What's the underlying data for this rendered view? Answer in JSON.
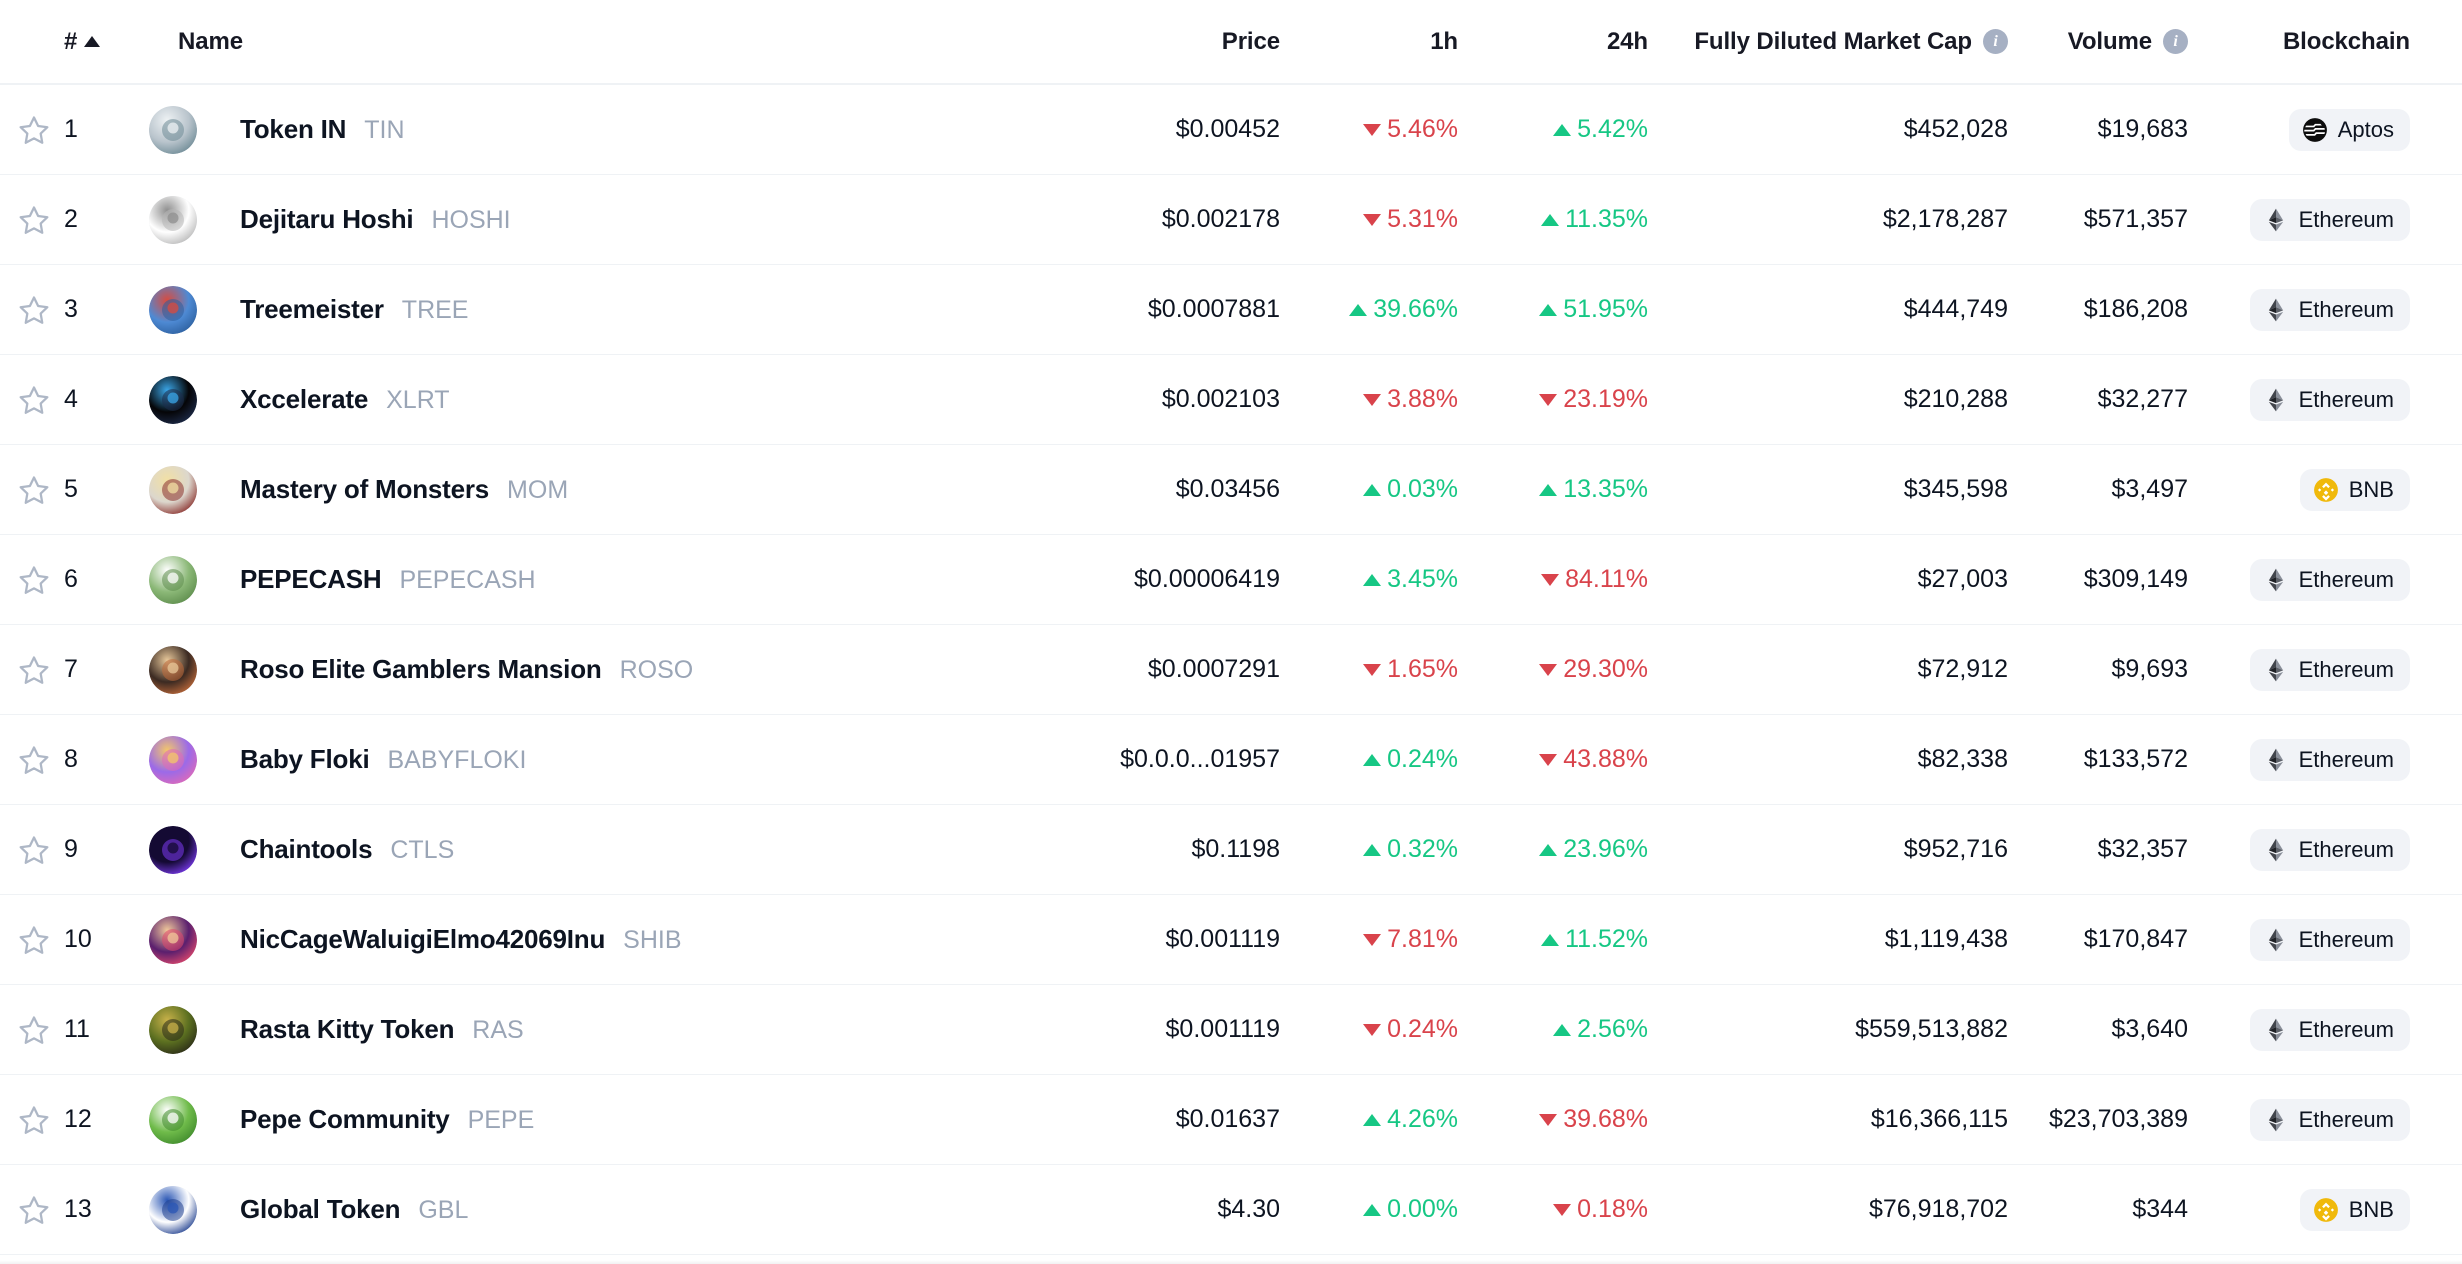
{
  "header": {
    "rank_label": "#",
    "sort_indicator": "ascending-caret",
    "name_label": "Name",
    "price_label": "Price",
    "h1_label": "1h",
    "h24_label": "24h",
    "fdmc_label": "Fully Diluted Market Cap",
    "fdmc_info": "i",
    "volume_label": "Volume",
    "volume_info": "i",
    "blockchain_label": "Blockchain"
  },
  "colors": {
    "up": "#16c784",
    "down": "#d9434b",
    "text": "#0d1421",
    "muted": "#9aa5b6",
    "divider": "#eff2f5",
    "badge_bg": "#f1f3f7",
    "bnb": "#f0b90b"
  },
  "rows": [
    {
      "rank": "1",
      "name": "Token IN",
      "symbol": "TIN",
      "price": "$0.00452",
      "h1": "5.46%",
      "h1_dir": "down",
      "h24": "5.42%",
      "h24_dir": "up",
      "fdmc": "$452,028",
      "volume": "$19,683",
      "chain": "Aptos",
      "chain_icon": "aptos-icon",
      "icon_name": "token-in-logo",
      "icon_colors": [
        "#b9c4cc",
        "#6d8a95",
        "#eef2f4"
      ]
    },
    {
      "rank": "2",
      "name": "Dejitaru Hoshi",
      "symbol": "HOSHI",
      "price": "$0.002178",
      "h1": "5.31%",
      "h1_dir": "down",
      "h24": "11.35%",
      "h24_dir": "up",
      "fdmc": "$2,178,287",
      "volume": "$571,357",
      "chain": "Ethereum",
      "chain_icon": "ethereum-icon",
      "icon_name": "dejitaru-hoshi-logo",
      "icon_colors": [
        "#ffffff",
        "#b7b7b7",
        "#8f8f8f"
      ]
    },
    {
      "rank": "3",
      "name": "Treemeister",
      "symbol": "TREE",
      "price": "$0.0007881",
      "h1": "39.66%",
      "h1_dir": "up",
      "h24": "51.95%",
      "h24_dir": "up",
      "fdmc": "$444,749",
      "volume": "$186,208",
      "chain": "Ethereum",
      "chain_icon": "ethereum-icon",
      "icon_name": "treemeister-logo",
      "icon_colors": [
        "#4e8ad4",
        "#2c5f9e",
        "#d84b3f"
      ]
    },
    {
      "rank": "4",
      "name": "Xccelerate",
      "symbol": "XLRT",
      "price": "$0.002103",
      "h1": "3.88%",
      "h1_dir": "down",
      "h24": "23.19%",
      "h24_dir": "down",
      "fdmc": "$210,288",
      "volume": "$32,277",
      "chain": "Ethereum",
      "chain_icon": "ethereum-icon",
      "icon_name": "xccelerate-logo",
      "icon_colors": [
        "#050507",
        "#1d2b4a",
        "#3aa6e8"
      ]
    },
    {
      "rank": "5",
      "name": "Mastery of Monsters",
      "symbol": "MOM",
      "price": "$0.03456",
      "h1": "0.03%",
      "h1_dir": "up",
      "h24": "13.35%",
      "h24_dir": "up",
      "fdmc": "$345,598",
      "volume": "$3,497",
      "chain": "BNB",
      "chain_icon": "bnb-icon",
      "icon_name": "mastery-of-monsters-logo",
      "icon_colors": [
        "#dcd7cd",
        "#8a2f2c",
        "#f2e0a4"
      ]
    },
    {
      "rank": "6",
      "name": "PEPECASH",
      "symbol": "PEPECASH",
      "price": "$0.00006419",
      "h1": "3.45%",
      "h1_dir": "up",
      "h24": "84.11%",
      "h24_dir": "down",
      "fdmc": "$27,003",
      "volume": "$309,149",
      "chain": "Ethereum",
      "chain_icon": "ethereum-icon",
      "icon_name": "pepecash-logo",
      "icon_colors": [
        "#8bb877",
        "#5d8c4c",
        "#ffffff"
      ]
    },
    {
      "rank": "7",
      "name": "Roso Elite Gamblers Mansion",
      "symbol": "ROSO",
      "price": "$0.0007291",
      "h1": "1.65%",
      "h1_dir": "down",
      "h24": "29.30%",
      "h24_dir": "down",
      "fdmc": "$72,912",
      "volume": "$9,693",
      "chain": "Ethereum",
      "chain_icon": "ethereum-icon",
      "icon_name": "roso-logo",
      "icon_colors": [
        "#3b2a22",
        "#c06a3a",
        "#e8c89a"
      ]
    },
    {
      "rank": "8",
      "name": "Baby Floki",
      "symbol": "BABYFLOKI",
      "price": "$0.0.0...01957",
      "h1": "0.24%",
      "h1_dir": "up",
      "h24": "43.88%",
      "h24_dir": "down",
      "fdmc": "$82,338",
      "volume": "$133,572",
      "chain": "Ethereum",
      "chain_icon": "ethereum-icon",
      "icon_name": "baby-floki-logo",
      "icon_colors": [
        "#9b6ae8",
        "#e06ab8",
        "#f3c76a"
      ]
    },
    {
      "rank": "9",
      "name": "Chaintools",
      "symbol": "CTLS",
      "price": "$0.1198",
      "h1": "0.32%",
      "h1_dir": "up",
      "h24": "23.96%",
      "h24_dir": "up",
      "fdmc": "$952,716",
      "volume": "$32,357",
      "chain": "Ethereum",
      "chain_icon": "ethereum-icon",
      "icon_name": "chaintools-logo",
      "icon_colors": [
        "#140a33",
        "#7b3bf0",
        "#140a33"
      ]
    },
    {
      "rank": "10",
      "name": "NicCageWaluigiElmo42069Inu",
      "symbol": "SHIB",
      "price": "$0.001119",
      "h1": "7.81%",
      "h1_dir": "down",
      "h24": "11.52%",
      "h24_dir": "up",
      "fdmc": "$1,119,438",
      "volume": "$170,847",
      "chain": "Ethereum",
      "chain_icon": "ethereum-icon",
      "icon_name": "niccage-logo",
      "icon_colors": [
        "#5a1f6e",
        "#e0486c",
        "#f0c89a"
      ]
    },
    {
      "rank": "11",
      "name": "Rasta Kitty Token",
      "symbol": "RAS",
      "price": "$0.001119",
      "h1": "0.24%",
      "h1_dir": "down",
      "h24": "2.56%",
      "h24_dir": "up",
      "fdmc": "$559,513,882",
      "volume": "$3,640",
      "chain": "Ethereum",
      "chain_icon": "ethereum-icon",
      "icon_name": "rasta-kitty-logo",
      "icon_colors": [
        "#5b6f20",
        "#2a2a18",
        "#c9b24a"
      ]
    },
    {
      "rank": "12",
      "name": "Pepe Community",
      "symbol": "PEPE",
      "price": "$0.01637",
      "h1": "4.26%",
      "h1_dir": "up",
      "h24": "39.68%",
      "h24_dir": "down",
      "fdmc": "$16,366,115",
      "volume": "$23,703,389",
      "chain": "Ethereum",
      "chain_icon": "ethereum-icon",
      "icon_name": "pepe-community-logo",
      "icon_colors": [
        "#6fbb4a",
        "#3f8a2c",
        "#ffffff"
      ]
    },
    {
      "rank": "13",
      "name": "Global Token",
      "symbol": "GBL",
      "price": "$4.30",
      "h1": "0.00%",
      "h1_dir": "up",
      "h24": "0.18%",
      "h24_dir": "down",
      "fdmc": "$76,918,702",
      "volume": "$344",
      "chain": "BNB",
      "chain_icon": "bnb-icon",
      "icon_name": "global-token-logo",
      "icon_colors": [
        "#ffffff",
        "#1f3f8f",
        "#2b57b5"
      ]
    }
  ]
}
